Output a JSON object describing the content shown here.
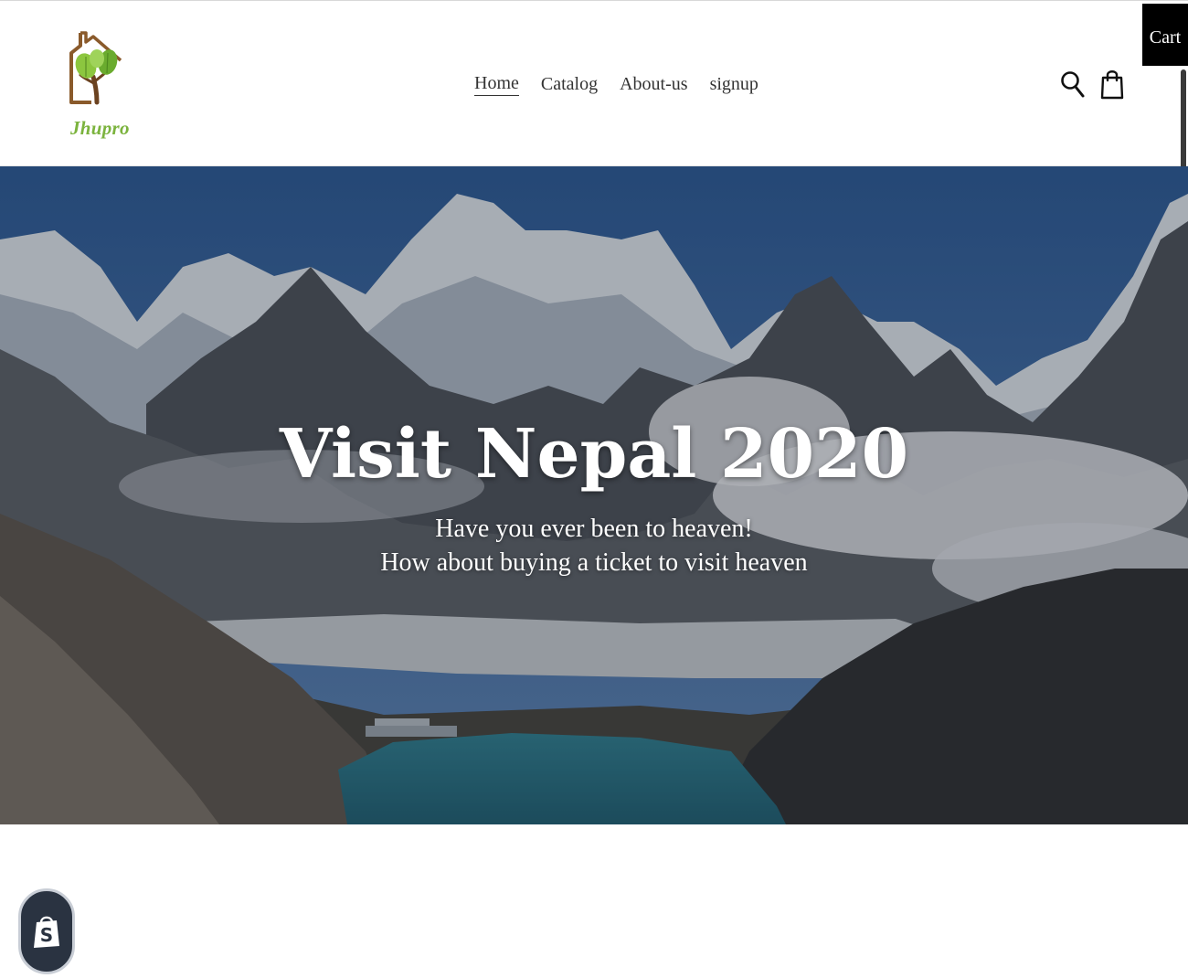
{
  "header": {
    "logo_text": "Jhupro",
    "nav": [
      {
        "label": "Home",
        "active": true
      },
      {
        "label": "Catalog",
        "active": false
      },
      {
        "label": "About-us",
        "active": false
      },
      {
        "label": "signup",
        "active": false
      }
    ],
    "search_icon": "search-icon",
    "bag_icon": "shopping-bag-icon",
    "cart_label": "Cart"
  },
  "hero": {
    "title": "Visit Nepal 2020",
    "subtitle_line1": "Have you ever been to heaven!",
    "subtitle_line2": "How about buying a ticket to visit heaven"
  },
  "badge": {
    "icon": "shopify-icon"
  },
  "colors": {
    "logo_green": "#7bb33d",
    "logo_brown": "#8a5a2b",
    "cart_bg": "#000000",
    "text_dark": "#333333",
    "badge_bg": "#2a3341"
  }
}
